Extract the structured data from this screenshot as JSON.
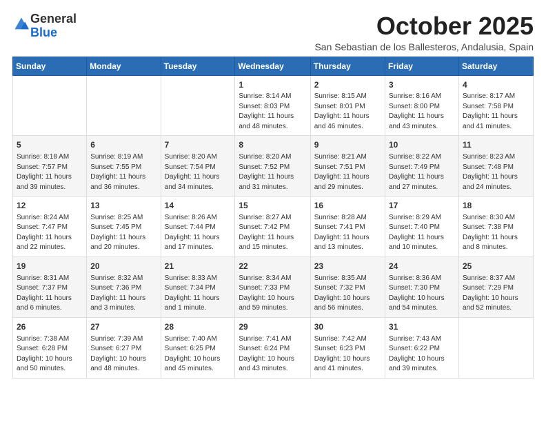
{
  "logo": {
    "general": "General",
    "blue": "Blue"
  },
  "header": {
    "month": "October 2025",
    "subtitle": "San Sebastian de los Ballesteros, Andalusia, Spain"
  },
  "weekdays": [
    "Sunday",
    "Monday",
    "Tuesday",
    "Wednesday",
    "Thursday",
    "Friday",
    "Saturday"
  ],
  "weeks": [
    [
      {
        "day": "",
        "info": ""
      },
      {
        "day": "",
        "info": ""
      },
      {
        "day": "",
        "info": ""
      },
      {
        "day": "1",
        "info": "Sunrise: 8:14 AM\nSunset: 8:03 PM\nDaylight: 11 hours\nand 48 minutes."
      },
      {
        "day": "2",
        "info": "Sunrise: 8:15 AM\nSunset: 8:01 PM\nDaylight: 11 hours\nand 46 minutes."
      },
      {
        "day": "3",
        "info": "Sunrise: 8:16 AM\nSunset: 8:00 PM\nDaylight: 11 hours\nand 43 minutes."
      },
      {
        "day": "4",
        "info": "Sunrise: 8:17 AM\nSunset: 7:58 PM\nDaylight: 11 hours\nand 41 minutes."
      }
    ],
    [
      {
        "day": "5",
        "info": "Sunrise: 8:18 AM\nSunset: 7:57 PM\nDaylight: 11 hours\nand 39 minutes."
      },
      {
        "day": "6",
        "info": "Sunrise: 8:19 AM\nSunset: 7:55 PM\nDaylight: 11 hours\nand 36 minutes."
      },
      {
        "day": "7",
        "info": "Sunrise: 8:20 AM\nSunset: 7:54 PM\nDaylight: 11 hours\nand 34 minutes."
      },
      {
        "day": "8",
        "info": "Sunrise: 8:20 AM\nSunset: 7:52 PM\nDaylight: 11 hours\nand 31 minutes."
      },
      {
        "day": "9",
        "info": "Sunrise: 8:21 AM\nSunset: 7:51 PM\nDaylight: 11 hours\nand 29 minutes."
      },
      {
        "day": "10",
        "info": "Sunrise: 8:22 AM\nSunset: 7:49 PM\nDaylight: 11 hours\nand 27 minutes."
      },
      {
        "day": "11",
        "info": "Sunrise: 8:23 AM\nSunset: 7:48 PM\nDaylight: 11 hours\nand 24 minutes."
      }
    ],
    [
      {
        "day": "12",
        "info": "Sunrise: 8:24 AM\nSunset: 7:47 PM\nDaylight: 11 hours\nand 22 minutes."
      },
      {
        "day": "13",
        "info": "Sunrise: 8:25 AM\nSunset: 7:45 PM\nDaylight: 11 hours\nand 20 minutes."
      },
      {
        "day": "14",
        "info": "Sunrise: 8:26 AM\nSunset: 7:44 PM\nDaylight: 11 hours\nand 17 minutes."
      },
      {
        "day": "15",
        "info": "Sunrise: 8:27 AM\nSunset: 7:42 PM\nDaylight: 11 hours\nand 15 minutes."
      },
      {
        "day": "16",
        "info": "Sunrise: 8:28 AM\nSunset: 7:41 PM\nDaylight: 11 hours\nand 13 minutes."
      },
      {
        "day": "17",
        "info": "Sunrise: 8:29 AM\nSunset: 7:40 PM\nDaylight: 11 hours\nand 10 minutes."
      },
      {
        "day": "18",
        "info": "Sunrise: 8:30 AM\nSunset: 7:38 PM\nDaylight: 11 hours\nand 8 minutes."
      }
    ],
    [
      {
        "day": "19",
        "info": "Sunrise: 8:31 AM\nSunset: 7:37 PM\nDaylight: 11 hours\nand 6 minutes."
      },
      {
        "day": "20",
        "info": "Sunrise: 8:32 AM\nSunset: 7:36 PM\nDaylight: 11 hours\nand 3 minutes."
      },
      {
        "day": "21",
        "info": "Sunrise: 8:33 AM\nSunset: 7:34 PM\nDaylight: 11 hours\nand 1 minute."
      },
      {
        "day": "22",
        "info": "Sunrise: 8:34 AM\nSunset: 7:33 PM\nDaylight: 10 hours\nand 59 minutes."
      },
      {
        "day": "23",
        "info": "Sunrise: 8:35 AM\nSunset: 7:32 PM\nDaylight: 10 hours\nand 56 minutes."
      },
      {
        "day": "24",
        "info": "Sunrise: 8:36 AM\nSunset: 7:30 PM\nDaylight: 10 hours\nand 54 minutes."
      },
      {
        "day": "25",
        "info": "Sunrise: 8:37 AM\nSunset: 7:29 PM\nDaylight: 10 hours\nand 52 minutes."
      }
    ],
    [
      {
        "day": "26",
        "info": "Sunrise: 7:38 AM\nSunset: 6:28 PM\nDaylight: 10 hours\nand 50 minutes."
      },
      {
        "day": "27",
        "info": "Sunrise: 7:39 AM\nSunset: 6:27 PM\nDaylight: 10 hours\nand 48 minutes."
      },
      {
        "day": "28",
        "info": "Sunrise: 7:40 AM\nSunset: 6:25 PM\nDaylight: 10 hours\nand 45 minutes."
      },
      {
        "day": "29",
        "info": "Sunrise: 7:41 AM\nSunset: 6:24 PM\nDaylight: 10 hours\nand 43 minutes."
      },
      {
        "day": "30",
        "info": "Sunrise: 7:42 AM\nSunset: 6:23 PM\nDaylight: 10 hours\nand 41 minutes."
      },
      {
        "day": "31",
        "info": "Sunrise: 7:43 AM\nSunset: 6:22 PM\nDaylight: 10 hours\nand 39 minutes."
      },
      {
        "day": "",
        "info": ""
      }
    ]
  ]
}
